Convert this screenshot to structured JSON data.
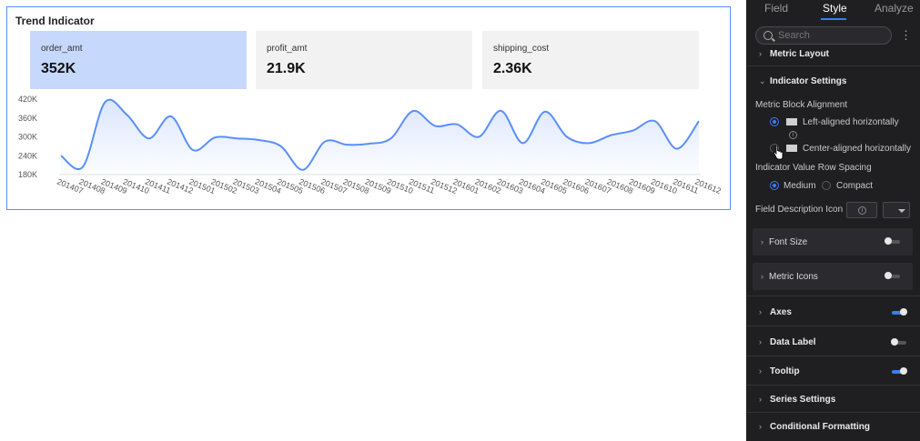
{
  "widget": {
    "title": "Trend Indicator",
    "metrics": [
      {
        "name": "order_amt",
        "value": "352K",
        "active": true
      },
      {
        "name": "profit_amt",
        "value": "21.9K",
        "active": false
      },
      {
        "name": "shipping_cost",
        "value": "2.36K",
        "active": false
      }
    ]
  },
  "chart_data": {
    "type": "area",
    "x": [
      "201407",
      "201408",
      "201409",
      "201410",
      "201411",
      "201412",
      "201501",
      "201502",
      "201503",
      "201504",
      "201505",
      "201506",
      "201507",
      "201508",
      "201509",
      "201510",
      "201511",
      "201512",
      "201601",
      "201602",
      "201603",
      "201604",
      "201605",
      "201606",
      "201607",
      "201608",
      "201609",
      "201610",
      "201611",
      "201612"
    ],
    "values": [
      240,
      205,
      410,
      370,
      295,
      365,
      258,
      298,
      295,
      290,
      270,
      195,
      285,
      275,
      278,
      295,
      382,
      335,
      340,
      300,
      383,
      280,
      380,
      300,
      280,
      305,
      320,
      350,
      262,
      350
    ],
    "y_ticks": [
      "180K",
      "240K",
      "300K",
      "360K",
      "420K"
    ],
    "ylim": [
      180,
      420
    ],
    "title": "",
    "xlabel": "",
    "ylabel": "",
    "line_color": "#5b8ff9"
  },
  "panel": {
    "tabs": [
      "Field",
      "Style",
      "Analyze"
    ],
    "active_tab": "Style",
    "search_placeholder": "Search",
    "metric_layout": "Metric Layout",
    "indicator_settings": "Indicator Settings",
    "metric_block_alignment": "Metric Block Alignment",
    "align_left": "Left-aligned horizontally",
    "align_center": "Center-aligned horizontally",
    "row_spacing": "Indicator Value Row Spacing",
    "spacing_medium": "Medium",
    "spacing_compact": "Compact",
    "field_desc_icon": "Field Description Icon",
    "font_size": "Font Size",
    "metric_icons": "Metric Icons",
    "axes": "Axes",
    "data_label": "Data Label",
    "tooltip": "Tooltip",
    "series_settings": "Series Settings",
    "conditional_formatting": "Conditional Formatting",
    "accent_color": "#3d7bf7"
  }
}
